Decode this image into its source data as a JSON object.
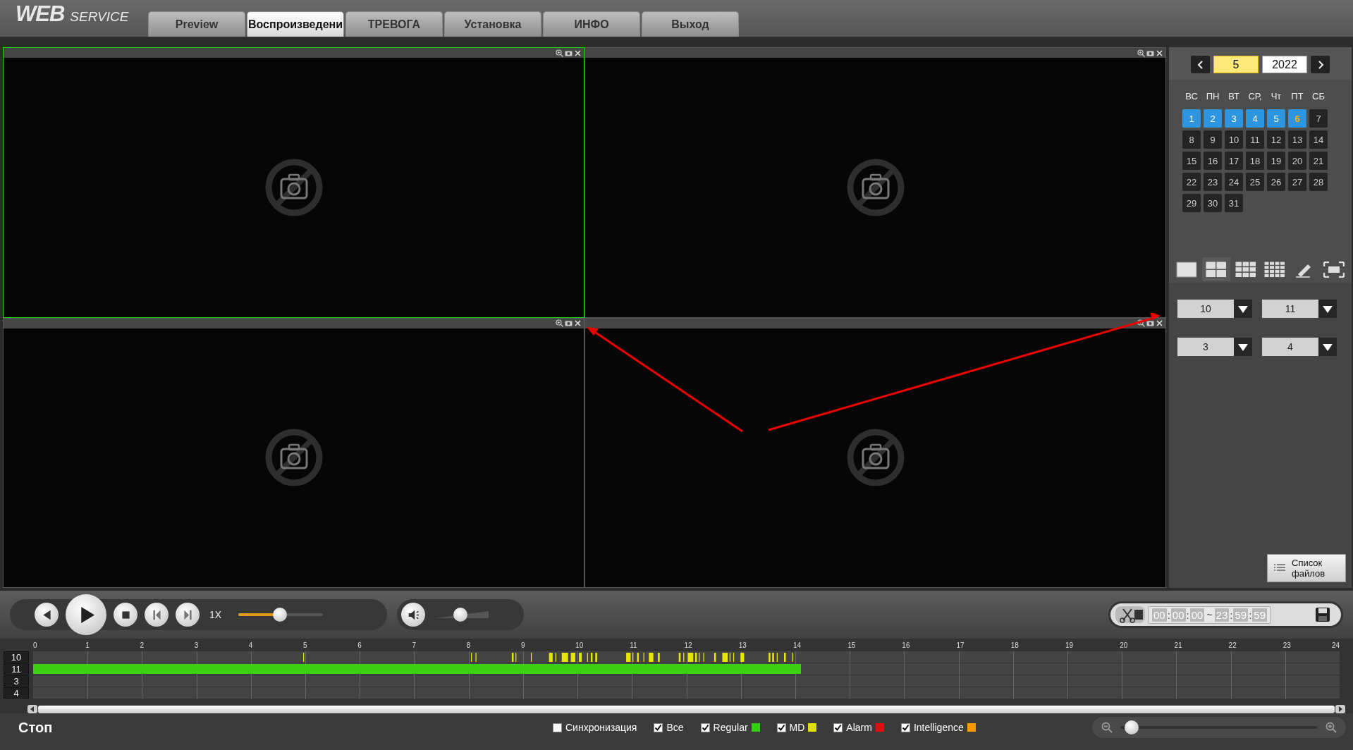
{
  "logo": {
    "primary": "WEB",
    "secondary": "SERVICE"
  },
  "tabs": [
    {
      "label": "Preview",
      "selected": false
    },
    {
      "label": "Воспроизведени",
      "selected": true
    },
    {
      "label": "ТРЕВОГА",
      "selected": false
    },
    {
      "label": "Установка",
      "selected": false
    },
    {
      "label": "ИНФО",
      "selected": false
    },
    {
      "label": "Выход",
      "selected": false
    }
  ],
  "video_tiles": [
    {
      "selected": true
    },
    {
      "selected": false
    },
    {
      "selected": false
    },
    {
      "selected": false
    }
  ],
  "calendar": {
    "month": "5",
    "year": "2022",
    "weekdays": [
      "ВС",
      "ПН",
      "ВТ",
      "СР,",
      "Чт",
      "ПТ",
      "СБ"
    ],
    "days": [
      {
        "label": "1",
        "recorded": true,
        "selected": false
      },
      {
        "label": "2",
        "recorded": true,
        "selected": false
      },
      {
        "label": "3",
        "recorded": true,
        "selected": false
      },
      {
        "label": "4",
        "recorded": true,
        "selected": false
      },
      {
        "label": "5",
        "recorded": true,
        "selected": false
      },
      {
        "label": "6",
        "recorded": true,
        "selected": true
      },
      {
        "label": "7",
        "recorded": false,
        "selected": false
      },
      {
        "label": "8",
        "recorded": false,
        "selected": false
      },
      {
        "label": "9",
        "recorded": false,
        "selected": false
      },
      {
        "label": "10",
        "recorded": false,
        "selected": false
      },
      {
        "label": "11",
        "recorded": false,
        "selected": false
      },
      {
        "label": "12",
        "recorded": false,
        "selected": false
      },
      {
        "label": "13",
        "recorded": false,
        "selected": false
      },
      {
        "label": "14",
        "recorded": false,
        "selected": false
      },
      {
        "label": "15",
        "recorded": false,
        "selected": false
      },
      {
        "label": "16",
        "recorded": false,
        "selected": false
      },
      {
        "label": "17",
        "recorded": false,
        "selected": false
      },
      {
        "label": "18",
        "recorded": false,
        "selected": false
      },
      {
        "label": "19",
        "recorded": false,
        "selected": false
      },
      {
        "label": "20",
        "recorded": false,
        "selected": false
      },
      {
        "label": "21",
        "recorded": false,
        "selected": false
      },
      {
        "label": "22",
        "recorded": false,
        "selected": false
      },
      {
        "label": "23",
        "recorded": false,
        "selected": false
      },
      {
        "label": "24",
        "recorded": false,
        "selected": false
      },
      {
        "label": "25",
        "recorded": false,
        "selected": false
      },
      {
        "label": "26",
        "recorded": false,
        "selected": false
      },
      {
        "label": "27",
        "recorded": false,
        "selected": false
      },
      {
        "label": "28",
        "recorded": false,
        "selected": false
      },
      {
        "label": "29",
        "recorded": false,
        "selected": false
      },
      {
        "label": "30",
        "recorded": false,
        "selected": false
      },
      {
        "label": "31",
        "recorded": false,
        "selected": false
      }
    ]
  },
  "layouts": [
    {
      "kind": "single",
      "selected": false
    },
    {
      "kind": "quad",
      "selected": true
    },
    {
      "kind": "nine",
      "selected": false
    },
    {
      "kind": "sixteen",
      "selected": false
    },
    {
      "kind": "edit",
      "selected": false
    },
    {
      "kind": "fullscreen",
      "selected": false
    }
  ],
  "channel_selects": [
    "10",
    "11",
    "3",
    "4"
  ],
  "file_list_button": "Список файлов",
  "playback": {
    "speed": "1X",
    "speed_slider": {
      "level": 0.49
    },
    "volume": {
      "level": 0.48
    }
  },
  "clip": {
    "start": [
      "00",
      ":",
      "00",
      ":",
      "00"
    ],
    "separator": "~",
    "end": [
      "23",
      ":",
      "59",
      ":",
      "59"
    ]
  },
  "timeline": {
    "hours": [
      "0",
      "1",
      "2",
      "3",
      "4",
      "5",
      "6",
      "7",
      "8",
      "9",
      "10",
      "11",
      "12",
      "13",
      "14",
      "15",
      "16",
      "17",
      "18",
      "19",
      "20",
      "21",
      "22",
      "23",
      "24"
    ],
    "channels": [
      {
        "label": "10",
        "kind": "motion"
      },
      {
        "label": "11",
        "kind": "regular"
      },
      {
        "label": "3",
        "kind": "empty"
      },
      {
        "label": "4",
        "kind": "empty"
      }
    ]
  },
  "status": "Стоп",
  "filters": [
    {
      "label": "Синхронизация",
      "checked": false
    },
    {
      "label": "Все",
      "checked": true
    },
    {
      "label": "Regular",
      "checked": true,
      "color": "#33cc11"
    },
    {
      "label": "MD",
      "checked": true,
      "color": "#e0e000"
    },
    {
      "label": "Alarm",
      "checked": true,
      "color": "#dd1111"
    },
    {
      "label": "Intelligence",
      "checked": true,
      "color": "#ff9900"
    }
  ],
  "zoom": {
    "level": 0.02
  }
}
